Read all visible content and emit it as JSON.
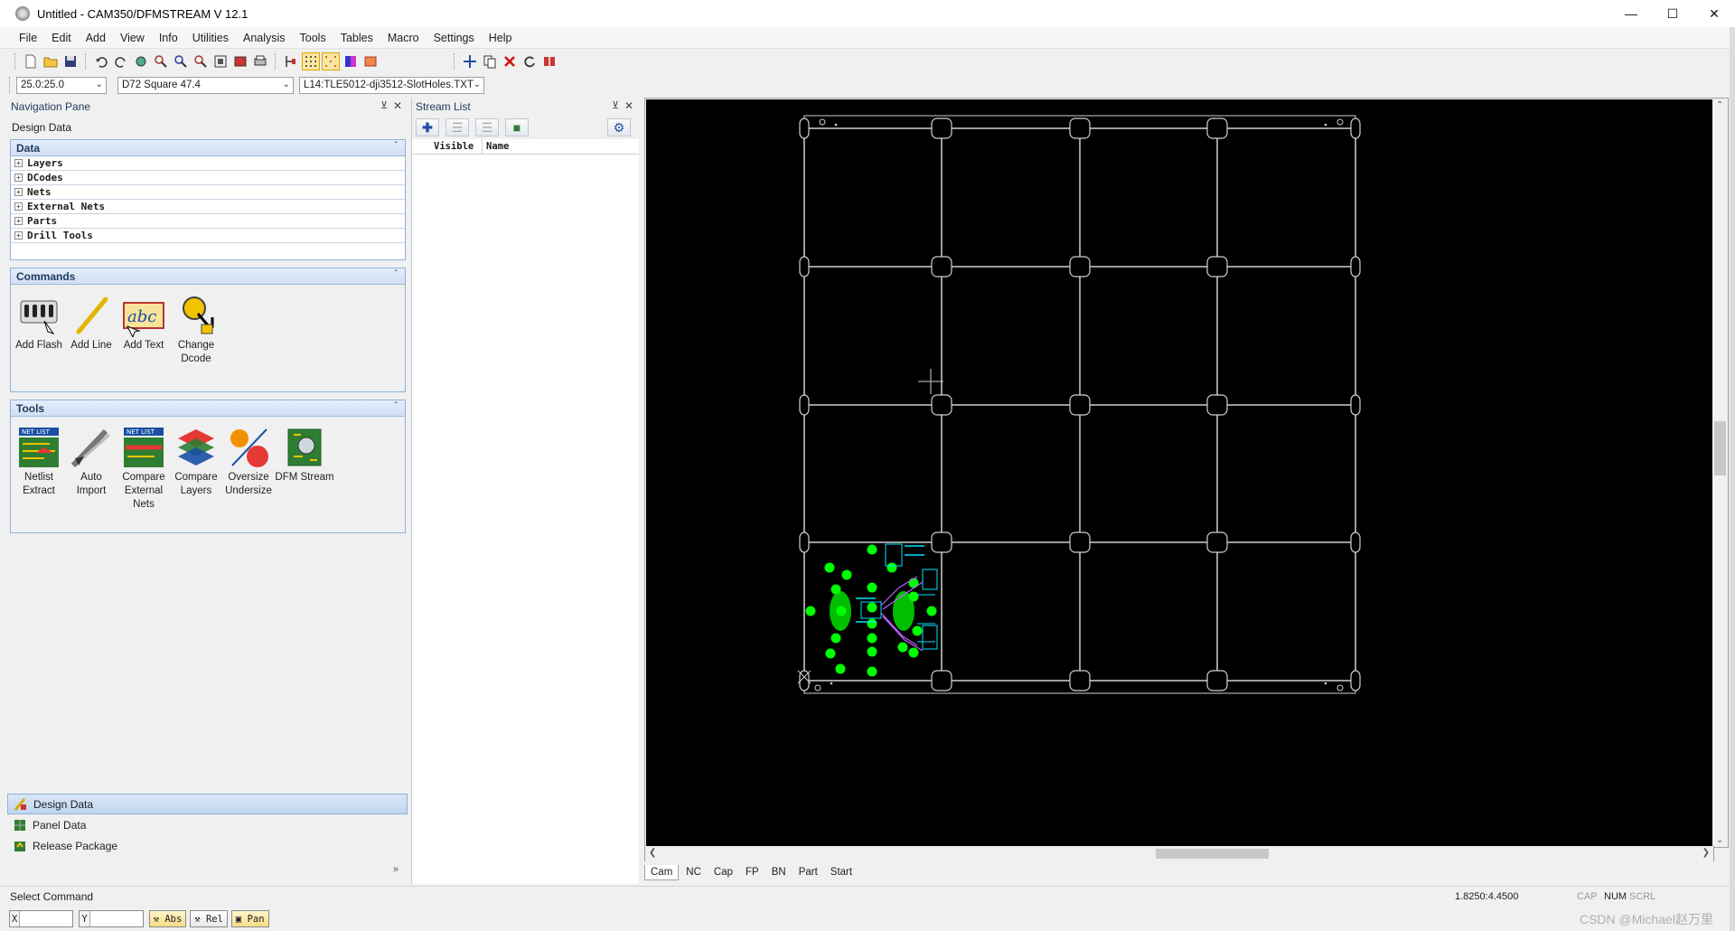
{
  "window": {
    "title": "Untitled - CAM350/DFMSTREAM V 12.1",
    "minimize": "—",
    "maximize": "☐",
    "close": "✕"
  },
  "menu": [
    "File",
    "Edit",
    "Add",
    "View",
    "Info",
    "Utilities",
    "Analysis",
    "Tools",
    "Tables",
    "Macro",
    "Settings",
    "Help"
  ],
  "combos": {
    "grid": "25.0:25.0",
    "dcode": "D72  Square 47.4",
    "layer": "L14:TLE5012-dji3512-SlotHoles.TXT"
  },
  "nav_pane": {
    "title": "Navigation Pane",
    "subtitle": "Design Data",
    "data_section": {
      "title": "Data",
      "items": [
        "Layers",
        "DCodes",
        "Nets",
        "External Nets",
        "Parts",
        "Drill Tools"
      ]
    },
    "commands_section": {
      "title": "Commands",
      "items": [
        {
          "label": "Add Flash",
          "icon": "add-flash-icon"
        },
        {
          "label": "Add Line",
          "icon": "add-line-icon"
        },
        {
          "label": "Add Text",
          "icon": "add-text-icon"
        },
        {
          "label": "Change Dcode",
          "icon": "change-dcode-icon"
        }
      ]
    },
    "tools_section": {
      "title": "Tools",
      "items": [
        {
          "label": "Netlist Extract",
          "icon": "netlist-extract-icon"
        },
        {
          "label": "Auto Import",
          "icon": "auto-import-icon"
        },
        {
          "label": "Compare External Nets",
          "icon": "compare-external-nets-icon"
        },
        {
          "label": "Compare Layers",
          "icon": "compare-layers-icon"
        },
        {
          "label": "Oversize Undersize",
          "icon": "oversize-undersize-icon"
        },
        {
          "label": "DFM Stream",
          "icon": "dfm-stream-icon"
        }
      ]
    },
    "bottom_items": [
      "Design Data",
      "Panel Data",
      "Release Package"
    ],
    "net_list_badge": "NET LIST",
    "abc_text": "abc"
  },
  "stream_list": {
    "title": "Stream List",
    "columns": [
      "Visible",
      "Name"
    ]
  },
  "canvas_tabs": [
    "Cam",
    "NC",
    "Cap",
    "FP",
    "BN",
    "Part",
    "Start"
  ],
  "status": {
    "message": "Select Command",
    "coords": "1.8250:4.4500",
    "indicators": [
      "CAP",
      "NUM",
      "SCRL"
    ],
    "watermark": "CSDN @Michael赵万里"
  },
  "coordbar": {
    "x_label": "X",
    "y_label": "Y",
    "abs": "Abs",
    "rel": "Rel",
    "pan": "Pan"
  },
  "colors": {
    "pcb_outline": "#d0d0d0",
    "pad": "#00ff00",
    "silk": "#00e5ff",
    "trace": "#c060ff"
  }
}
